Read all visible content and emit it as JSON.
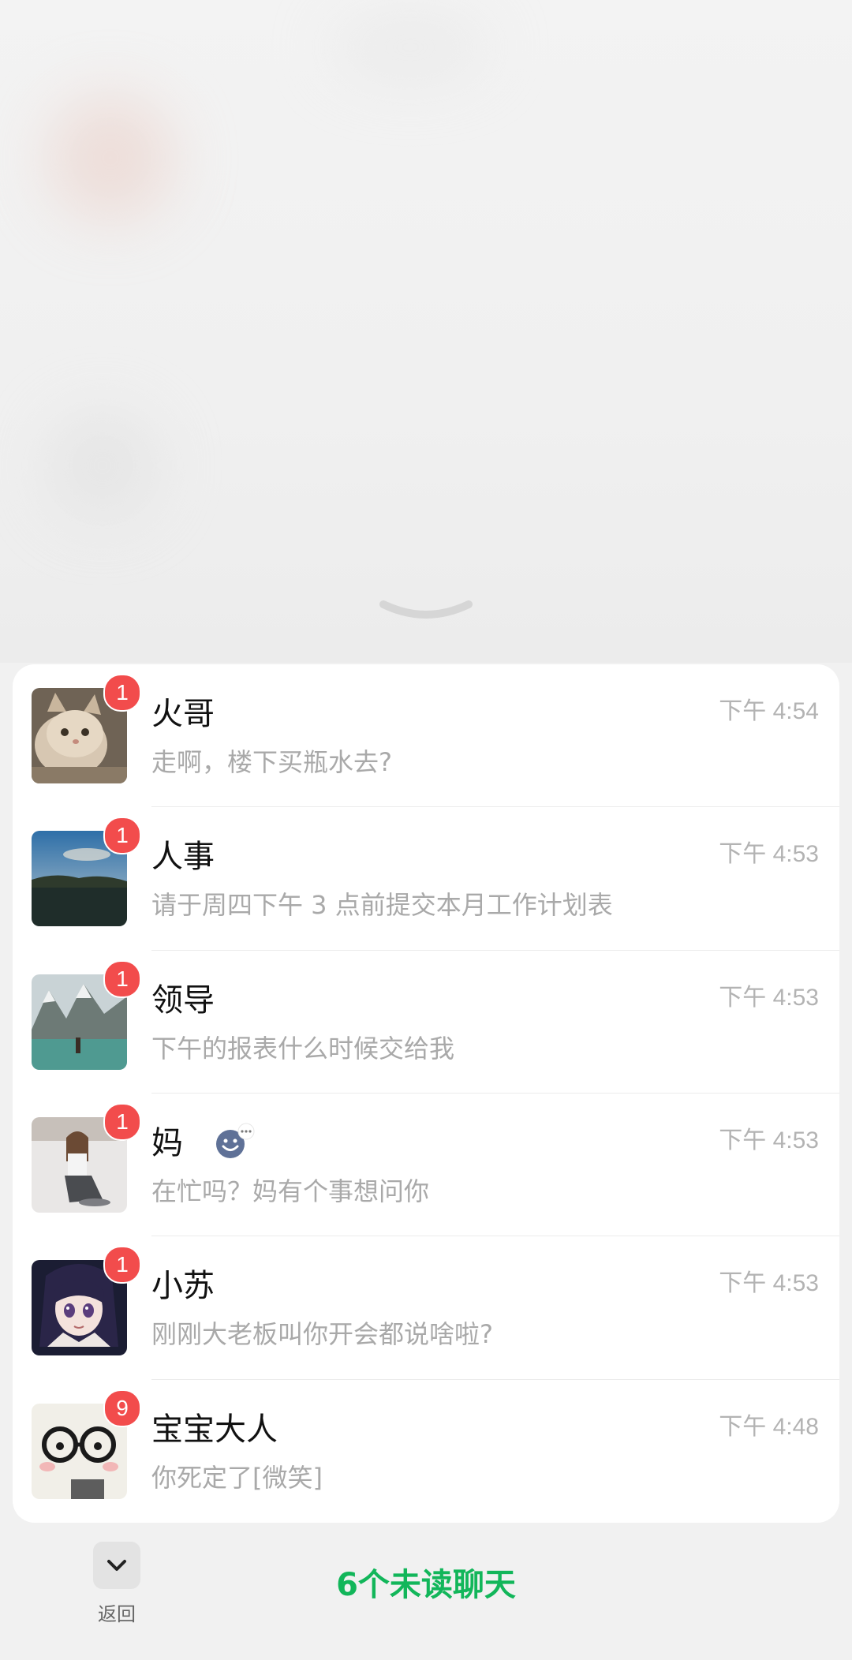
{
  "chats": [
    {
      "name": "火哥",
      "preview": "走啊，楼下买瓶水去?",
      "time": "下午 4:54",
      "badge": "1",
      "avatar": "cat-photo-avatar"
    },
    {
      "name": "人事",
      "preview": "请于周四下午 3 点前提交本月工作计划表",
      "time": "下午 4:53",
      "badge": "1",
      "avatar": "lake-sky-avatar"
    },
    {
      "name": "领导",
      "preview": "下午的报表什么时候交给我",
      "time": "下午 4:53",
      "badge": "1",
      "avatar": "mountain-lake-avatar"
    },
    {
      "name": "妈",
      "preview": "在忙吗？妈有个事想问你",
      "time": "下午 4:53",
      "badge": "1",
      "avatar": "snow-person-avatar",
      "status_icon": "smiley-status-icon"
    },
    {
      "name": "小苏",
      "preview": "刚刚大老板叫你开会都说啥啦?",
      "time": "下午 4:53",
      "badge": "1",
      "avatar": "anime-girl-avatar"
    },
    {
      "name": "宝宝大人",
      "preview": "你死定了[微笑]",
      "time": "下午 4:48",
      "badge": "9",
      "avatar": "glasses-cartoon-avatar"
    }
  ],
  "footer": {
    "back_label": "返回",
    "unread_summary": "6个未读聊天"
  },
  "colors": {
    "accent_green": "#12b65a",
    "badge_red": "#f24c4c",
    "meta_gray": "#b3b3b3"
  }
}
